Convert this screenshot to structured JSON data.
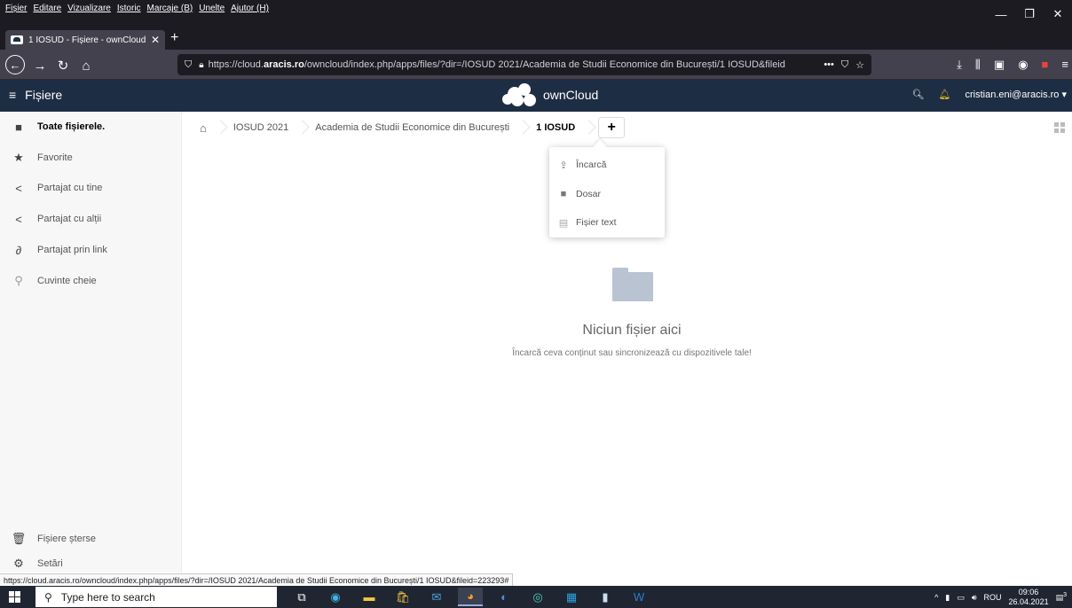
{
  "browser": {
    "menus": [
      "Fișier",
      "Editare",
      "Vizualizare",
      "Istoric",
      "Marcaje (B)",
      "Unelte",
      "Ajutor (H)"
    ],
    "tab_title": "1 IOSUD - Fișiere - ownCloud",
    "url_prefix": "https://cloud.",
    "url_domain": "aracis.ro",
    "url_rest": "/owncloud/index.php/apps/files/?dir=/IOSUD 2021/Academia de Studii Economice din București/1 IOSUD&fileid",
    "status_url": "https://cloud.aracis.ro/owncloud/index.php/apps/files/?dir=/IOSUD 2021/Academia de Studii Economice din București/1 IOSUD&fileid=223293#"
  },
  "header": {
    "app_title": "Fișiere",
    "logo_text": "ownCloud",
    "user": "cristian.eni@aracis.ro"
  },
  "sidebar": {
    "items": [
      {
        "label": "Toate fișierele.",
        "icon": "folder-icon"
      },
      {
        "label": "Favorite",
        "icon": "star-icon"
      },
      {
        "label": "Partajat cu tine",
        "icon": "share-icon"
      },
      {
        "label": "Partajat cu alții",
        "icon": "share-icon"
      },
      {
        "label": "Partajat prin link",
        "icon": "link-icon"
      },
      {
        "label": "Cuvinte cheie",
        "icon": "search-icon"
      }
    ],
    "trash": "Fișiere șterse",
    "settings": "Setări"
  },
  "breadcrumb": [
    "IOSUD 2021",
    "Academia de Studii Economice din București",
    "1 IOSUD"
  ],
  "new_menu": {
    "items": [
      {
        "label": "Încarcă",
        "icon": "upload-icon"
      },
      {
        "label": "Dosar",
        "icon": "folder-icon"
      },
      {
        "label": "Fișier text",
        "icon": "text-file-icon"
      }
    ]
  },
  "empty": {
    "title": "Niciun fișier aici",
    "subtitle": "Încarcă ceva conținut sau sincronizează cu dispozitivele tale!"
  },
  "taskbar": {
    "search_placeholder": "Type here to search",
    "lang": "ROU",
    "time": "09:06",
    "date": "26.04.2021",
    "notif_count": "3"
  },
  "colors": {
    "oc_header": "#1d2d44",
    "browser_dark": "#1c1b22"
  }
}
